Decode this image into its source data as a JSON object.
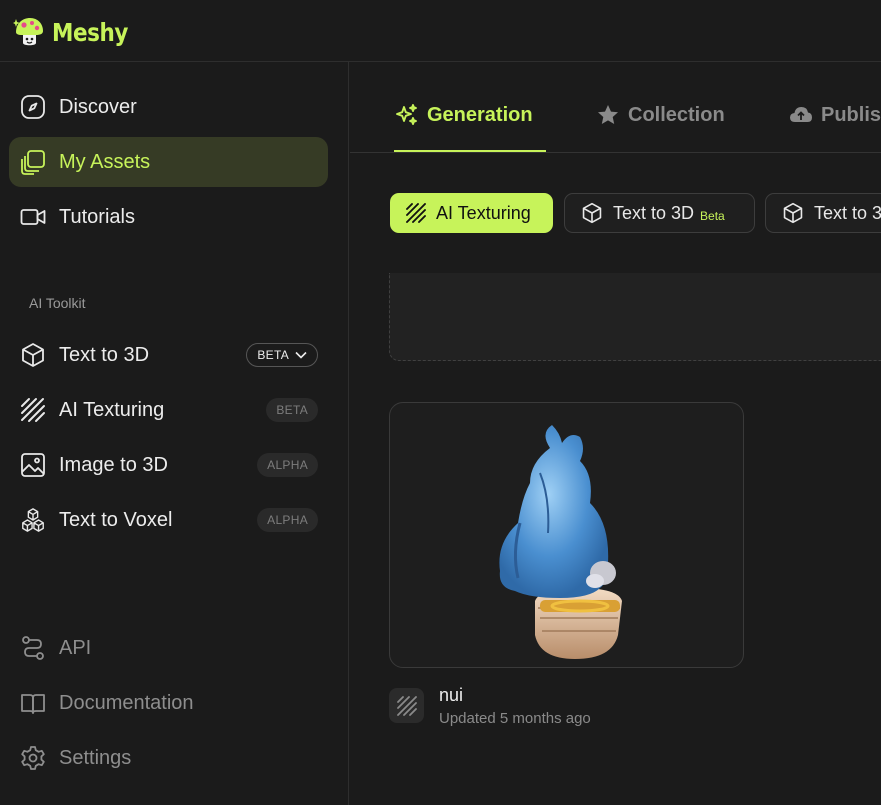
{
  "app": {
    "name": "Meshy",
    "accent": "#c7f35a"
  },
  "sidebar": {
    "items": [
      {
        "label": "Discover",
        "icon": "compass-icon"
      },
      {
        "label": "My Assets",
        "icon": "stacked-squares-icon",
        "active": true
      },
      {
        "label": "Tutorials",
        "icon": "video-camera-icon"
      }
    ],
    "toolkit_label": "AI Toolkit",
    "toolkit": [
      {
        "label": "Text to 3D",
        "icon": "cube-icon",
        "badge": "BETA"
      },
      {
        "label": "AI Texturing",
        "icon": "hatch-icon",
        "badge": "BETA"
      },
      {
        "label": "Image to 3D",
        "icon": "image-icon",
        "badge": "ALPHA"
      },
      {
        "label": "Text to Voxel",
        "icon": "cubes-icon",
        "badge": "ALPHA"
      }
    ],
    "footer": [
      {
        "label": "API",
        "icon": "route-icon"
      },
      {
        "label": "Documentation",
        "icon": "book-icon"
      },
      {
        "label": "Settings",
        "icon": "gear-icon"
      }
    ]
  },
  "tabs": [
    {
      "label": "Generation",
      "icon": "sparkle-icon",
      "active": true
    },
    {
      "label": "Collection",
      "icon": "star-icon"
    },
    {
      "label": "Publish",
      "icon": "cloud-upload-icon"
    }
  ],
  "filters": [
    {
      "label": "AI Texturing",
      "icon": "hatch-icon",
      "active": true
    },
    {
      "label": "Text to 3D",
      "icon": "cube-icon",
      "tag": "Beta"
    },
    {
      "label": "Text to 3",
      "icon": "cube-icon"
    }
  ],
  "asset": {
    "name": "nui",
    "updated": "Updated 5 months ago",
    "type_icon": "hatch-icon"
  }
}
